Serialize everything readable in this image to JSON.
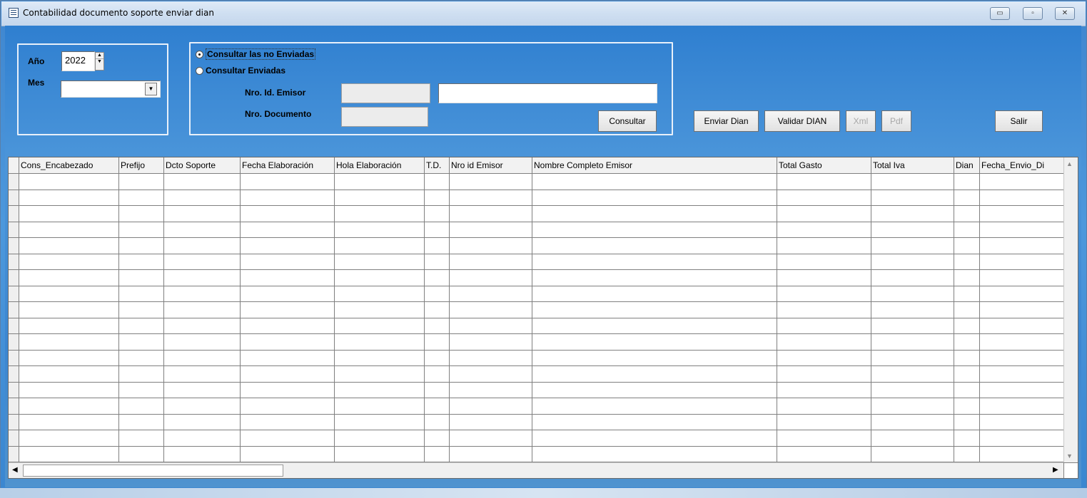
{
  "window": {
    "title": "Contabilidad documento soporte enviar dian",
    "controls": {
      "minimize": "▭",
      "maximize": "▫",
      "close": "✕"
    }
  },
  "period": {
    "year_label": "Año",
    "year_value": "2022",
    "month_label": "Mes",
    "month_value": ""
  },
  "query": {
    "option_not_sent": "Consultar las no Enviadas",
    "option_sent": "Consultar Enviadas",
    "selected_option": "not_sent",
    "emitter_id_label": "Nro. Id. Emisor",
    "emitter_id_value": "",
    "emitter_name_value": "",
    "document_label": "Nro. Documento",
    "document_value": "",
    "consult_button": "Consultar"
  },
  "actions": {
    "send_dian": "Enviar Dian",
    "validate_dian": "Validar DIAN",
    "xml": "Xml",
    "pdf": "Pdf",
    "exit": "Salir"
  },
  "grid": {
    "columns": [
      "Cons_Encabezado",
      "Prefijo",
      "Dcto Soporte",
      "Fecha Elaboración",
      "Hola Elaboración",
      "T.D.",
      "Nro id Emisor",
      "Nombre Completo Emisor",
      "Total Gasto",
      "Total Iva",
      "Dian",
      "Fecha_Envio_Di"
    ],
    "rows": []
  },
  "colors": {
    "client_background": "#3b86d1",
    "titlebar": "#cfdff1",
    "groupbox_border": "#e8f0fa"
  }
}
